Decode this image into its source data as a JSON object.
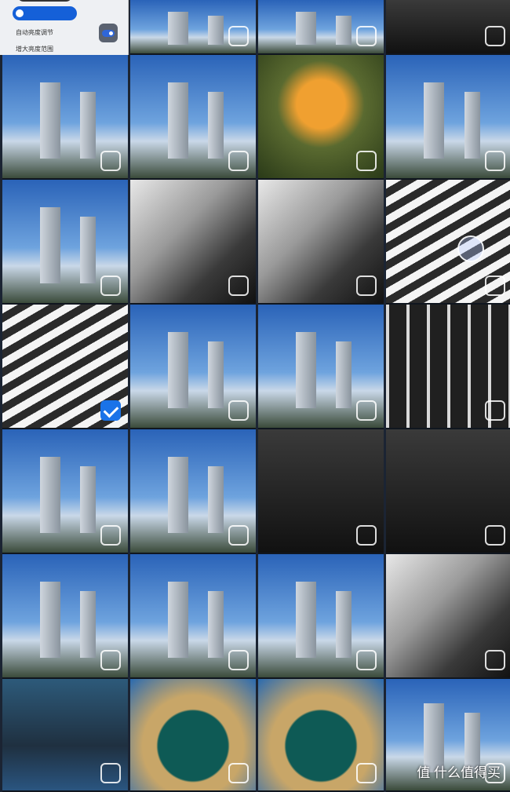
{
  "settings_panel": {
    "auto_brightness_label": "自动亮度调节",
    "extended_range_label": "增大亮度范围",
    "auto_brightness_on": true
  },
  "watermark": {
    "text": "值 什么值得买",
    "logo": "值"
  },
  "photos": [
    {
      "row": 0,
      "col": 0,
      "type": "settings"
    },
    {
      "row": 0,
      "col": 1,
      "type": "sky",
      "checked": false
    },
    {
      "row": 0,
      "col": 2,
      "type": "sky",
      "checked": false
    },
    {
      "row": 0,
      "col": 3,
      "type": "dark",
      "checked": false
    },
    {
      "row": 1,
      "col": 0,
      "type": "sky",
      "checked": false
    },
    {
      "row": 1,
      "col": 1,
      "type": "sky",
      "checked": false
    },
    {
      "row": 1,
      "col": 2,
      "type": "yellow",
      "checked": false
    },
    {
      "row": 1,
      "col": 3,
      "type": "sky",
      "checked": false
    },
    {
      "row": 2,
      "col": 0,
      "type": "sky",
      "checked": false
    },
    {
      "row": 2,
      "col": 1,
      "type": "bw",
      "checked": false
    },
    {
      "row": 2,
      "col": 2,
      "type": "bw",
      "checked": false
    },
    {
      "row": 2,
      "col": 3,
      "type": "stripes",
      "checked": false
    },
    {
      "row": 3,
      "col": 0,
      "type": "stripes",
      "checked": true
    },
    {
      "row": 3,
      "col": 1,
      "type": "sky",
      "checked": false
    },
    {
      "row": 3,
      "col": 2,
      "type": "sky",
      "checked": false
    },
    {
      "row": 3,
      "col": 3,
      "type": "vstripes",
      "checked": false
    },
    {
      "row": 4,
      "col": 0,
      "type": "sky",
      "checked": false
    },
    {
      "row": 4,
      "col": 1,
      "type": "sky",
      "checked": false
    },
    {
      "row": 4,
      "col": 2,
      "type": "dark",
      "checked": false
    },
    {
      "row": 4,
      "col": 3,
      "type": "dark",
      "checked": false
    },
    {
      "row": 5,
      "col": 0,
      "type": "sky",
      "checked": false
    },
    {
      "row": 5,
      "col": 1,
      "type": "sky",
      "checked": false
    },
    {
      "row": 5,
      "col": 2,
      "type": "sky",
      "checked": false
    },
    {
      "row": 5,
      "col": 3,
      "type": "bw",
      "checked": false
    },
    {
      "row": 6,
      "col": 0,
      "type": "posts",
      "checked": false
    },
    {
      "row": 6,
      "col": 1,
      "type": "teal",
      "checked": false
    },
    {
      "row": 6,
      "col": 2,
      "type": "teal",
      "checked": false
    },
    {
      "row": 6,
      "col": 3,
      "type": "sky",
      "checked": false
    }
  ],
  "accent_color": "#1a73e8"
}
